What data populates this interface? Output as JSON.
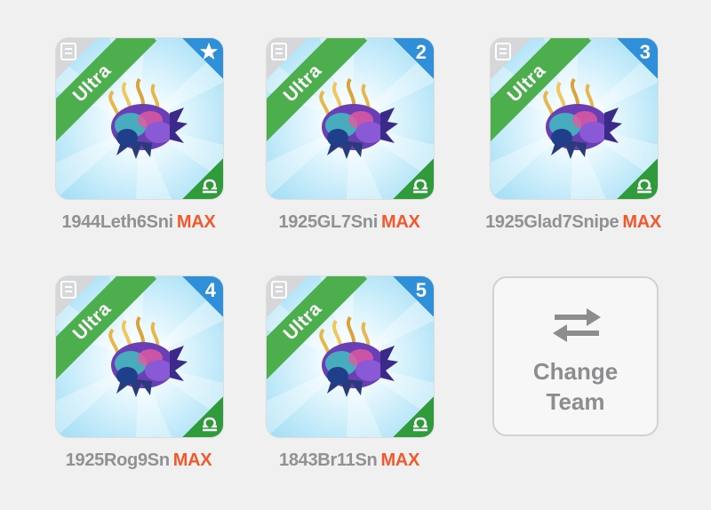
{
  "team": [
    {
      "name": "1944Leth6Sni",
      "level": "MAX",
      "rarity": "Ultra",
      "rank": "",
      "rank_icon": "star-icon",
      "element_icon": "libra-icon"
    },
    {
      "name": "1925GL7Sni",
      "level": "MAX",
      "rarity": "Ultra",
      "rank": "2",
      "element_icon": "libra-icon"
    },
    {
      "name": "1925Glad7Snipe",
      "level": "MAX",
      "rarity": "Ultra",
      "rank": "3",
      "element_icon": "libra-icon"
    },
    {
      "name": "1925Rog9Sn",
      "level": "MAX",
      "rarity": "Ultra",
      "rank": "4",
      "element_icon": "libra-icon"
    },
    {
      "name": "1843Br11Sn",
      "level": "MAX",
      "rarity": "Ultra",
      "rank": "5",
      "element_icon": "libra-icon"
    }
  ],
  "change_team": {
    "label": "Change\nTeam",
    "icon": "swap-arrows-icon"
  },
  "colors": {
    "background": "#f0f0f1",
    "ribbon_green": "#4cae4c",
    "rank_blue": "#2f8fd8",
    "element_green": "#2f9b3a",
    "max_orange": "#f1582d",
    "name_gray": "#8f9193"
  }
}
